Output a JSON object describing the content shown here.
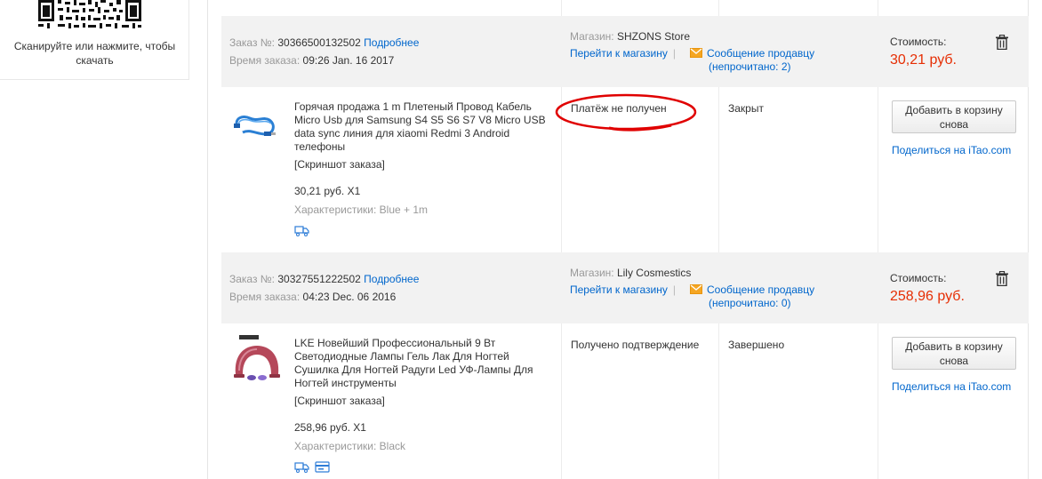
{
  "qr_panel": {
    "caption": "Сканируйте или нажмите, чтобы скачать"
  },
  "labels": {
    "order_no": "Заказ №:",
    "details": "Подробнее",
    "order_time": "Время заказа:",
    "store": "Магазин:",
    "go_to_store": "Перейти к магазину",
    "separator": "|",
    "message_seller": "Сообщение продавцу",
    "unread_prefix": "(непрочитано: ",
    "unread_suffix": ")",
    "cost": "Стоимость:",
    "screenshot": "[Скриншот заказа]",
    "characteristics": "Характеристики:",
    "add_to_cart": "Добавить в корзину снова",
    "share_prefix": "Поделиться на ",
    "share_site": "iTao.com"
  },
  "orders": [
    {
      "number": "30366500132502",
      "time": "09:26 Jan. 16 2017",
      "store": "SHZONS Store",
      "unread": "2",
      "cost": "30,21 руб.",
      "product_title": "Горячая продажа 1 m Плетеный Провод Кабель Micro Usb для Samsung S4 S5 S6 S7 V8 Micro USB data sync линия для xiaomi Redmi 3 Android телефоны",
      "unit_price": "30,21 руб. X1",
      "characteristics": "Blue + 1m",
      "payment_status": "Платёж не получен",
      "order_status": "Закрыт",
      "highlight_color": "#e00000"
    },
    {
      "number": "30327551222502",
      "time": "04:23 Dec. 06 2016",
      "store": "Lily Cosmestics",
      "unread": "0",
      "cost": "258,96 руб.",
      "product_title": "LKE Новейший Профессиональный 9 Вт Светодиодные Лампы Гель Лак Для Ногтей Сушилка Для Ногтей Радуги Led УФ-Лампы Для Ногтей инструменты",
      "unit_price": "258,96 руб. X1",
      "characteristics": "Black",
      "payment_status": "Получено подтверждение",
      "order_status": "Завершено"
    }
  ],
  "colors": {
    "link": "#0066cc",
    "price": "#e62e04",
    "header_bg": "#f2f2f2",
    "mail_icon": "#f5a623"
  },
  "icons": {
    "qr": "qr-code",
    "trash": "trash-icon",
    "mail": "mail-icon",
    "shipping": "truck-icon",
    "card": "card-icon"
  }
}
